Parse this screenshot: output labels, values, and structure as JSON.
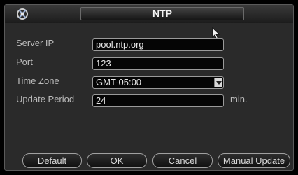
{
  "dialog": {
    "title": "NTP"
  },
  "form": {
    "server_ip": {
      "label": "Server IP",
      "value": "pool.ntp.org"
    },
    "port": {
      "label": "Port",
      "value": "123"
    },
    "time_zone": {
      "label": "Time Zone",
      "value": "GMT-05:00"
    },
    "update_period": {
      "label": "Update Period",
      "value": "24",
      "unit": "min."
    }
  },
  "buttons": {
    "default": "Default",
    "ok": "OK",
    "cancel": "Cancel",
    "manual_update": "Manual Update"
  }
}
